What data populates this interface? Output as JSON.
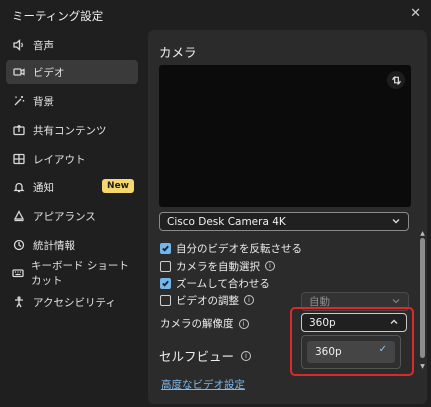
{
  "window": {
    "title": "ミーティング設定",
    "close_symbol": "✕"
  },
  "sidebar": {
    "items": [
      {
        "label": "音声",
        "icon": "speaker-icon"
      },
      {
        "label": "ビデオ",
        "icon": "video-icon",
        "active": true
      },
      {
        "label": "背景",
        "icon": "magic-wand-icon"
      },
      {
        "label": "共有コンテンツ",
        "icon": "share-icon"
      },
      {
        "label": "レイアウト",
        "icon": "layout-icon"
      },
      {
        "label": "通知",
        "icon": "bell-icon",
        "badge": "New"
      },
      {
        "label": "アピアランス",
        "icon": "appearance-icon"
      },
      {
        "label": "統計情報",
        "icon": "stats-icon"
      },
      {
        "label": "キーボード ショートカット",
        "icon": "keyboard-icon"
      },
      {
        "label": "アクセシビリティ",
        "icon": "accessibility-icon"
      }
    ]
  },
  "camera": {
    "heading": "カメラ",
    "device": "Cisco Desk Camera 4K",
    "options": [
      {
        "label": "自分のビデオを反転させる",
        "checked": true,
        "info": false
      },
      {
        "label": "カメラを自動選択",
        "checked": false,
        "info": true
      },
      {
        "label": "ズームして合わせる",
        "checked": true,
        "info": false
      },
      {
        "label": "ビデオの調整",
        "checked": false,
        "info": true
      }
    ],
    "adjust_value": "自動",
    "resolution_label": "カメラの解像度",
    "resolution_value": "360p",
    "resolution_options": [
      {
        "label": "360p",
        "selected": true
      }
    ]
  },
  "self_view": {
    "heading": "セルフビュー"
  },
  "advanced_link": "高度なビデオ設定",
  "colors": {
    "accent": "#74b6ea",
    "highlight_border": "#d92b2b",
    "badge": "#f5d76e"
  }
}
